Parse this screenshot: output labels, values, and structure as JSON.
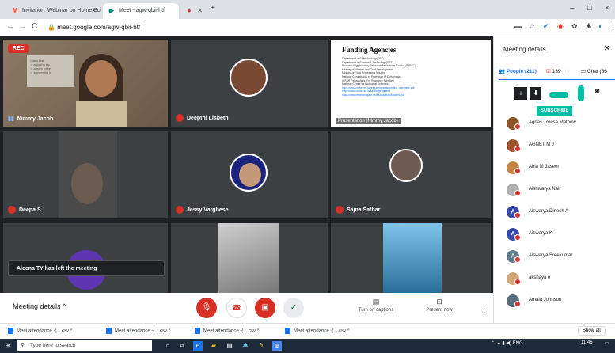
{
  "browser": {
    "tabs": [
      {
        "icon": "gmail-icon",
        "title": "Invitation: Webinar on Home Sci",
        "color": "#ea4335"
      },
      {
        "icon": "meet-icon",
        "title": "Meet - agw-qbii-htf",
        "color": "#00897b"
      },
      {
        "icon": "record-icon",
        "title": "",
        "color": "#d93025"
      }
    ],
    "new_tab": "+",
    "url": "meet.google.com/agw-qbii-htf",
    "window_controls": [
      "–",
      "□",
      "×"
    ]
  },
  "meeting": {
    "rec_label": "REC",
    "tiles": [
      {
        "name": "Nimmy Jacob"
      },
      {
        "name": "Deepthi Lisbeth"
      },
      {
        "name": "Presentation (Nimmy Jacob)"
      },
      {
        "name": "Deepa S"
      },
      {
        "name": "Jessy Varghese"
      },
      {
        "name": "Sajna Sathar"
      }
    ],
    "board_text": [
      "Class List",
      "✓ aniggha mp",
      "✓ ansiey babe",
      "✓ sangeetha k"
    ],
    "slide": {
      "title": "Funding Agencies",
      "items": [
        "Department of Biotechnology(DBT)",
        "Department of Science & Technology(DST)",
        "Biotechnology Industry Research Assistance Council (BIRAC)",
        "Ministry of Women and Child Development",
        "Ministry of Food Processing Industry",
        "National Commission of Protection of Child rights",
        "ICSSR Fellowships- For Research Scholars",
        "National Centre for Biological Sciences"
      ],
      "links": [
        "https://www.ncbs.res.in/researchgrants/funding_agencies.pdf",
        "https://www.ncbs.res.in/fundingprograms",
        "https://www.researchgate.net/publication/funders.pdf"
      ]
    },
    "toast": "Aleena TY has left the meeting"
  },
  "controls": {
    "meeting_details": "Meeting details",
    "captions": "Turn on captions",
    "present": "Present now"
  },
  "panel": {
    "title": "Meeting details",
    "people_tab": "People (211)",
    "chat_tab": "Chat (66",
    "reaction_count": "139",
    "subscribe": "SUBSCRIBE",
    "participants": [
      {
        "name": "Agnas Treesa Mathew",
        "initial": "",
        "color": "#8d5524"
      },
      {
        "name": "AGNET M J",
        "initial": "",
        "color": "#a0522d"
      },
      {
        "name": "Ahla M Jaseer",
        "initial": "",
        "color": "#c68642"
      },
      {
        "name": "Aishwarya Nair",
        "initial": "",
        "color": "#b0b0b0"
      },
      {
        "name": "Aiswarya Dinesh A",
        "initial": "A",
        "color": "#3949ab"
      },
      {
        "name": "Aiswarya K",
        "initial": "A",
        "color": "#3949ab"
      },
      {
        "name": "Aiswarya Sreekumar",
        "initial": "A",
        "color": "#607d8b"
      },
      {
        "name": "akshaya e",
        "initial": "",
        "color": "#d2a679"
      },
      {
        "name": "Amala Johnson",
        "initial": "",
        "color": "#5d6d7e"
      }
    ]
  },
  "downloads": {
    "items": [
      "Meet attendance -(....csv",
      "Meet attendance -(....csv",
      "Meet attendance -(....csv",
      "Meet attendance -(....csv"
    ],
    "show_all": "Show all"
  },
  "taskbar": {
    "search_placeholder": "Type here to search",
    "clock_time": "11:46",
    "lang": "ENG"
  }
}
